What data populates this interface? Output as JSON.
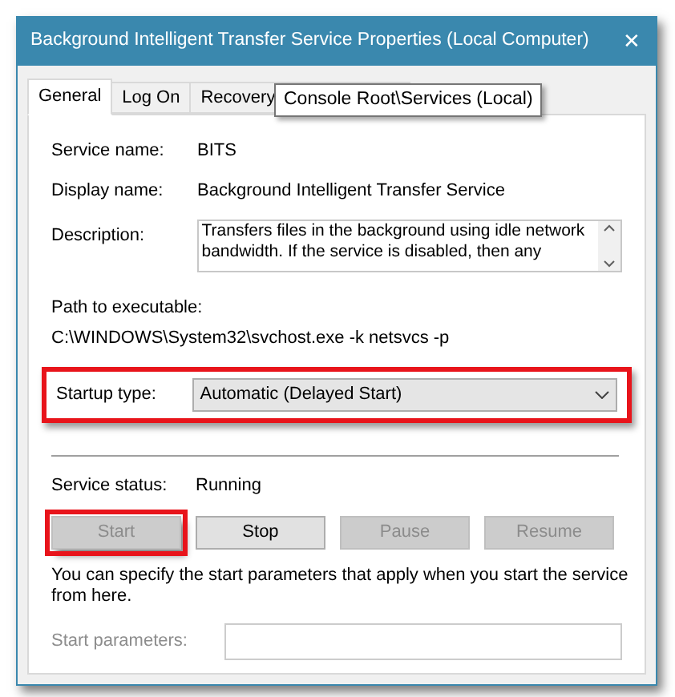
{
  "window": {
    "title": "Background Intelligent Transfer Service Properties (Local Computer)",
    "close": "✕"
  },
  "tabs": [
    {
      "label": "General",
      "selected": true
    },
    {
      "label": "Log On",
      "selected": false
    },
    {
      "label": "Recovery",
      "selected": false
    },
    {
      "selected": false
    }
  ],
  "tooltip": "Console Root\\Services (Local)",
  "fields": [
    {
      "label": "Service name:",
      "value": "BITS"
    },
    {
      "label": "Display name:",
      "value": "Background Intelligent Transfer Service"
    }
  ],
  "description": {
    "label": "Description:",
    "value": "Transfers files in the background using idle network bandwidth. If the service is disabled, then any"
  },
  "path": {
    "label": "Path to executable:",
    "value": "C:\\WINDOWS\\System32\\svchost.exe -k netsvcs -p"
  },
  "startup_type": {
    "label": "Startup type:",
    "value": "Automatic (Delayed Start)",
    "highlighted": true
  },
  "service_status": {
    "label": "Service status:",
    "value": "Running"
  },
  "buttons": [
    {
      "label": "Start",
      "disabled": true,
      "highlighted": true
    },
    {
      "label": "Stop",
      "disabled": false,
      "highlighted": false
    },
    {
      "label": "Pause",
      "disabled": true,
      "highlighted": false
    },
    {
      "label": "Resume",
      "disabled": true,
      "highlighted": false
    }
  ],
  "hint": "You can specify the start parameters that apply when you start the service from here.",
  "start_parameters": {
    "label": "Start parameters:",
    "disabled": true
  }
}
